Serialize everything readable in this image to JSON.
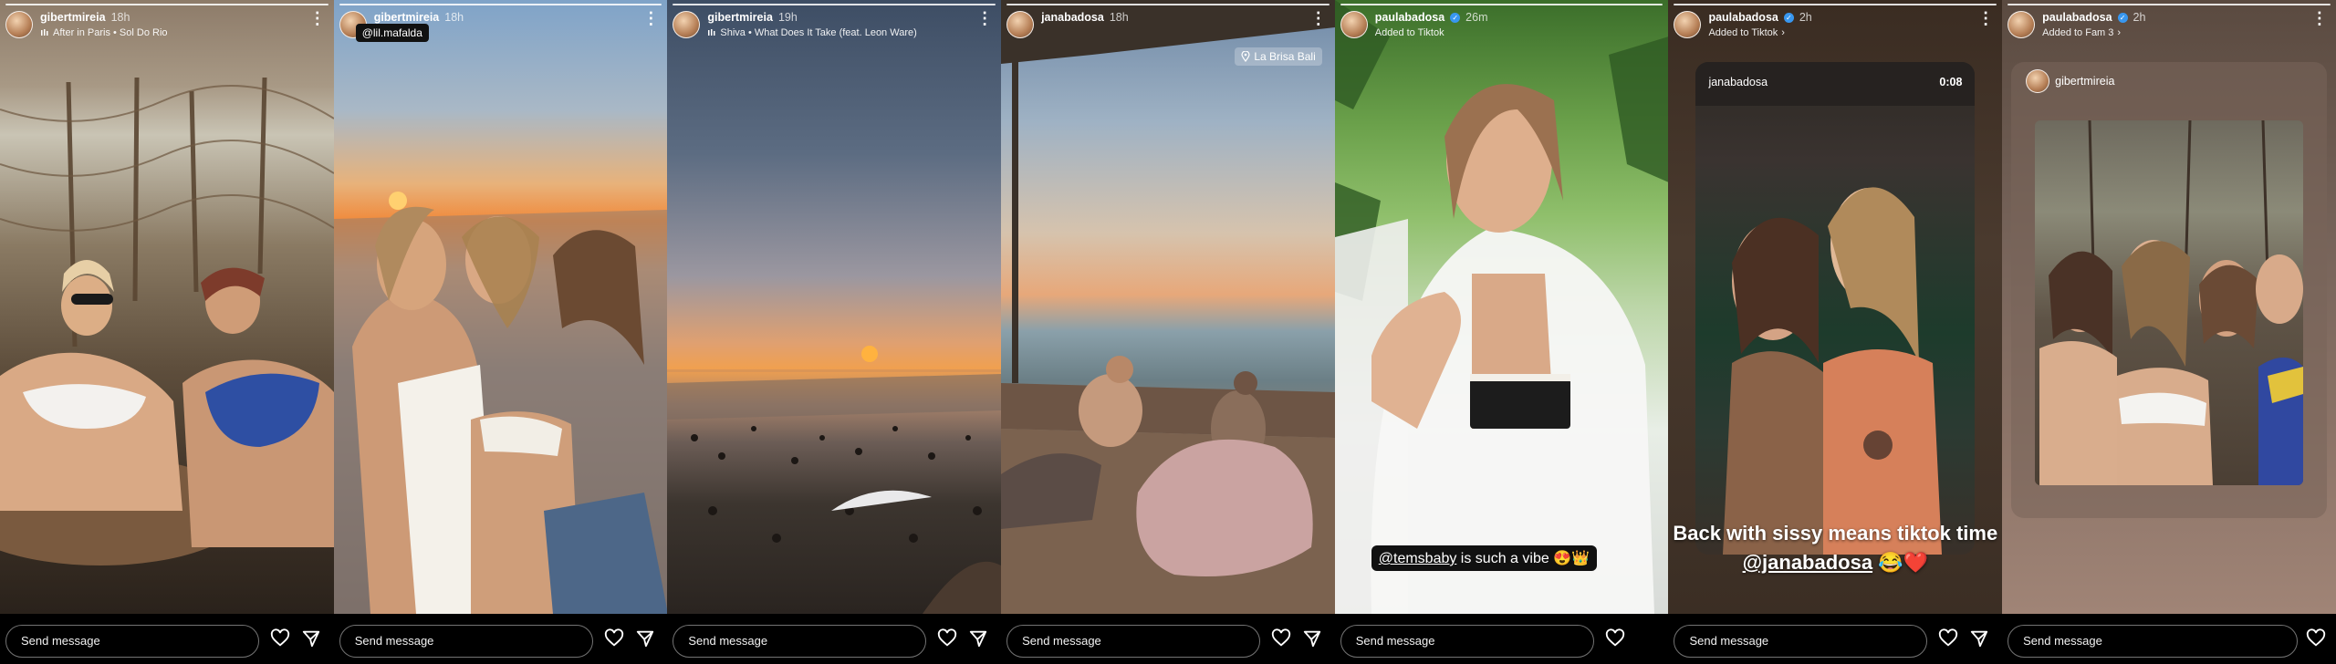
{
  "footer": {
    "send_placeholder": "Send message"
  },
  "panels": [
    {
      "user": "gibertmireia",
      "time": "18h",
      "sub": "After in Paris • Sol Do Rio",
      "verified": false
    },
    {
      "user": "gibertmireia",
      "time": "18h",
      "sub": "",
      "overlay_tag": "@lil.mafalda",
      "verified": false
    },
    {
      "user": "gibertmireia",
      "time": "19h",
      "sub": "Shiva • What Does It Take (feat. Leon Ware)",
      "verified": false
    },
    {
      "user": "janabadosa",
      "time": "18h",
      "sub": "",
      "location": "La Brisa Bali",
      "verified": false
    },
    {
      "user": "paulabadosa",
      "time": "26m",
      "sub": "Added to Tiktok",
      "verified": true,
      "caption_mention": "@temsbaby",
      "caption_rest": " is such a vibe 😍👑"
    },
    {
      "user": "paulabadosa",
      "time": "2h",
      "sub": "Added to Tiktok",
      "verified": true,
      "card_user": "janabadosa",
      "card_time": "0:08",
      "caption_line1": "Back with sissy means tiktok time",
      "caption_mention": "@janabadosa",
      "caption_emoji": " 😂❤️"
    },
    {
      "user": "paulabadosa",
      "time": "2h",
      "sub": "Added to Fam 3",
      "verified": true,
      "card_user": "gibertmireia"
    }
  ],
  "icons": {
    "music": "music-note-icon",
    "more": "more-dots-icon",
    "heart": "heart-icon",
    "send": "send-icon",
    "location": "location-pin-icon",
    "chevron": "chevron-right-icon"
  }
}
